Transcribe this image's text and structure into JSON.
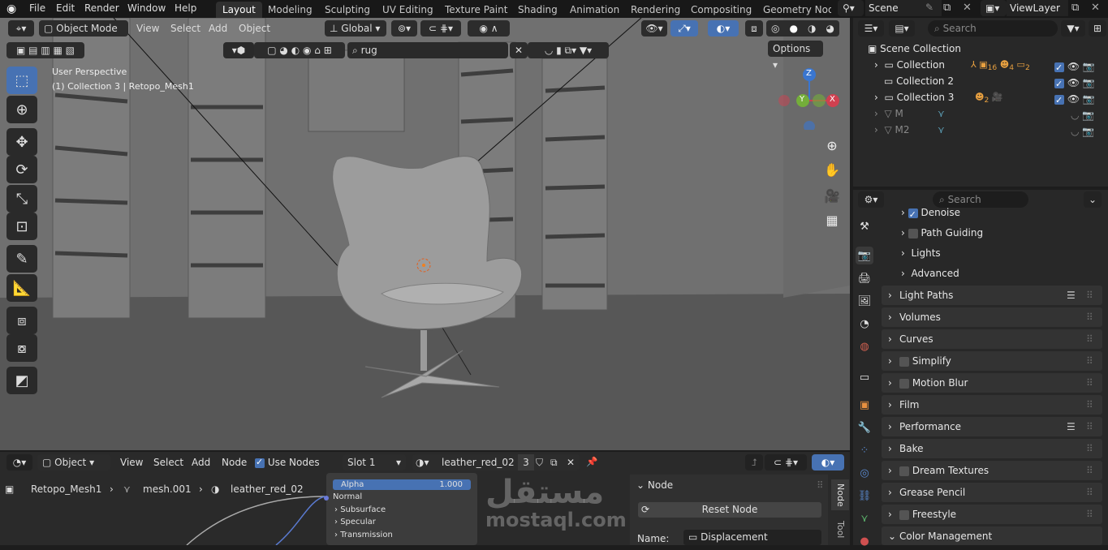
{
  "topbar": {
    "menus": [
      "File",
      "Edit",
      "Render",
      "Window",
      "Help"
    ],
    "workspaces": [
      "Layout",
      "Modeling",
      "Sculpting",
      "UV Editing",
      "Texture Paint",
      "Shading",
      "Animation",
      "Rendering",
      "Compositing",
      "Geometry Node"
    ],
    "active_workspace": "Layout",
    "scene": "Scene",
    "view_layer": "ViewLayer"
  },
  "viewport": {
    "mode": "Object Mode",
    "menus": [
      "View",
      "Select",
      "Add",
      "Object"
    ],
    "transform_orientation": "Global",
    "filter_text": "rug",
    "options_label": "Options",
    "perspective_label": "User Perspective",
    "object_label": "(1) Collection 3 | Retopo_Mesh1",
    "gizmo": {
      "z": "Z",
      "y": "Y",
      "x": "X"
    }
  },
  "outliner": {
    "search_placeholder": "Search",
    "root": "Scene Collection",
    "rows": [
      {
        "label": "Collection",
        "badge_a": "16",
        "badge_b": "4",
        "badge_c": "2"
      },
      {
        "label": "Collection 2"
      },
      {
        "label": "Collection 3",
        "badge_a": "2"
      },
      {
        "label": "M"
      },
      {
        "label": "M2"
      }
    ]
  },
  "properties": {
    "search_placeholder": "Search",
    "sub_items": [
      {
        "label": "Denoise",
        "checked": true
      },
      {
        "label": "Path Guiding",
        "checked": false
      },
      {
        "label": "Lights"
      },
      {
        "label": "Advanced"
      }
    ],
    "panels": [
      {
        "label": "Light Paths",
        "list": true
      },
      {
        "label": "Volumes"
      },
      {
        "label": "Curves"
      },
      {
        "label": "Simplify",
        "check": true
      },
      {
        "label": "Motion Blur",
        "check": true
      },
      {
        "label": "Film"
      },
      {
        "label": "Performance",
        "list": true
      },
      {
        "label": "Bake"
      },
      {
        "label": "Dream Textures",
        "check": true
      },
      {
        "label": "Grease Pencil"
      },
      {
        "label": "Freestyle",
        "check": true
      },
      {
        "label": "Color Management"
      }
    ]
  },
  "node_editor": {
    "editor_type": "Object",
    "menus": [
      "View",
      "Select",
      "Add",
      "Node"
    ],
    "use_nodes_label": "Use Nodes",
    "slot": "Slot 1",
    "material": "leather_red_02",
    "users": "3",
    "breadcrumb": [
      "Retopo_Mesh1",
      "mesh.001",
      "leather_red_02"
    ],
    "alpha_label": "Alpha",
    "alpha_value": "1.000",
    "sockets": [
      "Normal",
      "Subsurface",
      "Specular",
      "Transmission"
    ],
    "node_panel_title": "Node",
    "reset_node_label": "Reset Node",
    "name_label": "Name:",
    "name_value": "Displacement",
    "tab_node": "Node",
    "tab_tool": "Tool"
  },
  "watermark": {
    "arabic": "مستقل",
    "latin": "mostaql.com"
  }
}
